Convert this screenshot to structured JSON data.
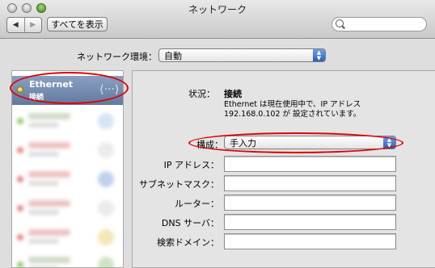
{
  "window": {
    "title": "ネットワーク"
  },
  "toolbar": {
    "back_glyph": "◀",
    "forward_glyph": "▶",
    "show_all_label": "すべてを表示",
    "search_placeholder": ""
  },
  "location": {
    "label": "ネットワーク環境：",
    "value": "自動"
  },
  "services": [
    {
      "name": "Ethernet",
      "status": "接続",
      "selected": true,
      "icon": "ethernet-arrows-icon"
    }
  ],
  "detail": {
    "status_label": "状況：",
    "status_value": "接続",
    "status_description": "Ethernet は現在使用中で、IP アドレス 192.168.0.102 が 設定されています。",
    "configure_label": "構成：",
    "configure_value": "手入力",
    "fields": [
      {
        "label": "IP アドレス：",
        "value": ""
      },
      {
        "label": "サブネットマスク：",
        "value": ""
      },
      {
        "label": "ルーター：",
        "value": ""
      },
      {
        "label": "DNS サーバ：",
        "value": ""
      },
      {
        "label": "検索ドメイン：",
        "value": ""
      }
    ]
  },
  "colors": {
    "annotation_red": "#e00000",
    "selection": "#6f87ad",
    "popup_arrow": "#3b6fcf"
  }
}
